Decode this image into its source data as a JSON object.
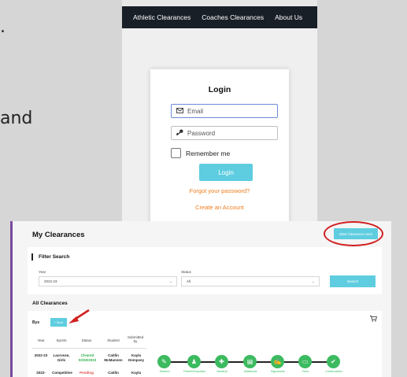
{
  "slide": {
    "fragment_dot": ".",
    "fragment_and": "and"
  },
  "login_page": {
    "nav_items": [
      "Athletic Clearances",
      "Coaches Clearances",
      "About Us"
    ],
    "title": "Login",
    "email_placeholder": "Email",
    "password_placeholder": "Password",
    "remember_label": "Remember me",
    "login_button": "Login",
    "forgot_link": "Forgot your password?",
    "create_link": "Create an Account",
    "link_color": "#ef7d1d",
    "accent": "#5fcde0"
  },
  "clearances": {
    "title": "My Clearances",
    "start_button": "Start Clearance Here",
    "filter_title": "Filter Search",
    "year_label": "Year",
    "year_value": "2022-23",
    "status_label": "Status",
    "status_value": "All",
    "search_button": "Search",
    "all_title": "All Clearances",
    "bys_label": "Bys",
    "sport_button": "+ Sport",
    "columns": [
      "Year",
      "Sports",
      "Status",
      "Student",
      "Submitted by"
    ],
    "rows": [
      {
        "year": "2022-23",
        "sport": "Lacrosse, Girls",
        "status": "Cleared 02/20/2023",
        "student": "Caitlin McMannen",
        "submitted": "Kayla Dempsey"
      },
      {
        "year": "2022-",
        "sport": "Competitive",
        "status": "Pending",
        "student": "Caitlin",
        "submitted": "Kayla"
      }
    ],
    "steps": [
      "Student",
      "Parent/Guardian",
      "Medical",
      "Additional",
      "Signatures",
      "Fees",
      "Confirmation"
    ],
    "highlight_color": "#d21f1f",
    "step_color": "#3cba5f"
  }
}
